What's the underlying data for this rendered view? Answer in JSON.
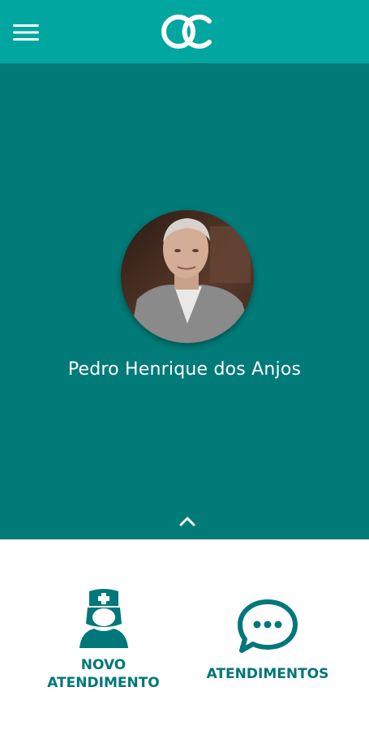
{
  "header": {
    "menu_icon": "hamburger-menu-icon",
    "logo_icon": "oc-logo-icon"
  },
  "profile": {
    "name": "Pedro Henrique dos Anjos"
  },
  "actions": [
    {
      "line1": "NOVO",
      "line2": "ATENDIMENTO",
      "icon": "nurse-icon"
    },
    {
      "label": "ATENDIMENTOS",
      "icon": "chat-bubble-icon"
    }
  ],
  "colors": {
    "app_bar": "#00a6a0",
    "hero": "#007b78",
    "accent": "#00777a",
    "background": "#ffffff"
  }
}
